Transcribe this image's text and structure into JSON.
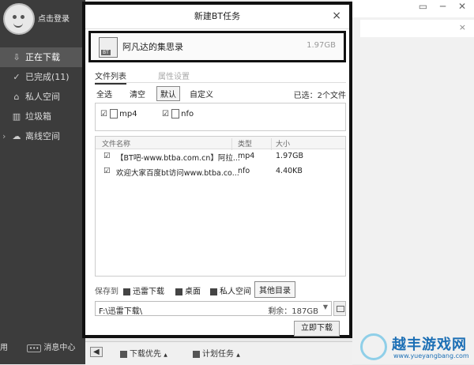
{
  "sidebar": {
    "login": "点击登录",
    "items": [
      {
        "label": "正在下载",
        "icon": "download-icon",
        "glyph": "⇩"
      },
      {
        "label": "已完成(11)",
        "icon": "check-circle-icon",
        "glyph": "✓"
      },
      {
        "label": "私人空间",
        "icon": "lock-icon",
        "glyph": "⌂"
      },
      {
        "label": "垃圾箱",
        "icon": "trash-icon",
        "glyph": "▥"
      },
      {
        "label": "离线空间",
        "icon": "cloud-icon",
        "glyph": "☁",
        "chevron": "›"
      }
    ],
    "bottom_left": "用",
    "message_center": "消息中心",
    "message_icon_text": "•••"
  },
  "dialog": {
    "title": "新建BT任务",
    "close": "×",
    "task": {
      "name": "阿凡达的集思录",
      "size": "1.97GB",
      "icon_label": "BT"
    },
    "tabs": [
      {
        "label": "文件列表",
        "active": true
      },
      {
        "label": "属性设置",
        "active": false
      }
    ],
    "toolbar": {
      "select_all": "全选",
      "clear": "清空",
      "default": "默认",
      "custom": "自定义",
      "selected_count": "已选：2个文件"
    },
    "types": [
      {
        "label": "mp4",
        "checked": "☑"
      },
      {
        "label": "nfo",
        "checked": "☑"
      }
    ],
    "columns": {
      "name": "文件名称",
      "type": "类型",
      "size": "大小"
    },
    "files": [
      {
        "check": "☑",
        "name": "【BT吧-www.btba.com.cn】阿拉...",
        "type": "mp4",
        "size": "1.97GB"
      },
      {
        "check": "☑",
        "name": "欢迎大家百度bt访问www.btba.co...",
        "type": "nfo",
        "size": "4.40KB"
      }
    ],
    "save_to": {
      "label": "保存到",
      "options": [
        {
          "label": "迅雷下载"
        },
        {
          "label": "桌面"
        },
        {
          "label": "私人空间"
        }
      ],
      "other": "其他目录"
    },
    "path": {
      "value": "F:\\迅雷下载\\",
      "free": "剩余：187GB",
      "dropdown": "▼"
    },
    "download_button": "立即下载"
  },
  "bottom_bar": {
    "priority": "下载优先",
    "schedule": "计划任务",
    "back": "◀",
    "caret": "▲"
  },
  "window_controls": "▭ ─ ✕",
  "right_close": "×",
  "watermark": {
    "text": "越丰游戏网",
    "url": "www.yueyangbang.com"
  }
}
